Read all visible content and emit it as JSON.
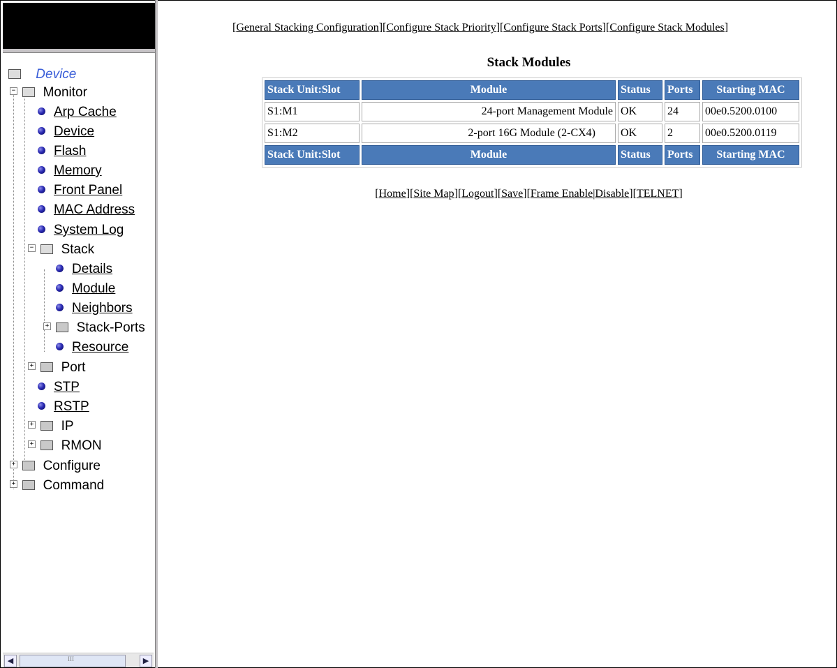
{
  "top_nav": [
    "General Stacking Configuration",
    "Configure Stack Priority",
    "Configure Stack Ports",
    "Configure Stack Modules"
  ],
  "page_title": "Stack Modules",
  "table": {
    "headers": [
      "Stack Unit:Slot",
      "Module",
      "Status",
      "Ports",
      "Starting MAC"
    ],
    "rows": [
      [
        "S1:M1",
        "24-port Management Module",
        "OK",
        "24",
        "00e0.5200.0100"
      ],
      [
        "S1:M2",
        "2-port 16G Module (2-CX4)",
        "OK",
        "2",
        "00e0.5200.0119"
      ]
    ]
  },
  "bottom_nav": [
    "Home",
    "Site Map",
    "Logout",
    "Save",
    "Frame Enable",
    "Disable",
    "TELNET"
  ],
  "tree": {
    "root": "Device",
    "monitor": "Monitor",
    "monitor_items": [
      "Arp Cache",
      "Device",
      "Flash",
      "Memory",
      "Front Panel",
      "MAC Address",
      "System Log"
    ],
    "stack": "Stack",
    "stack_items": [
      "Details",
      "Module",
      "Neighbors"
    ],
    "stack_ports": "Stack-Ports",
    "resource": "Resource",
    "port": "Port",
    "stp": "STP",
    "rstp": "RSTP",
    "ip": "IP",
    "rmon": "RMON",
    "configure": "Configure",
    "command": "Command"
  },
  "scrollbar_grip": "III"
}
